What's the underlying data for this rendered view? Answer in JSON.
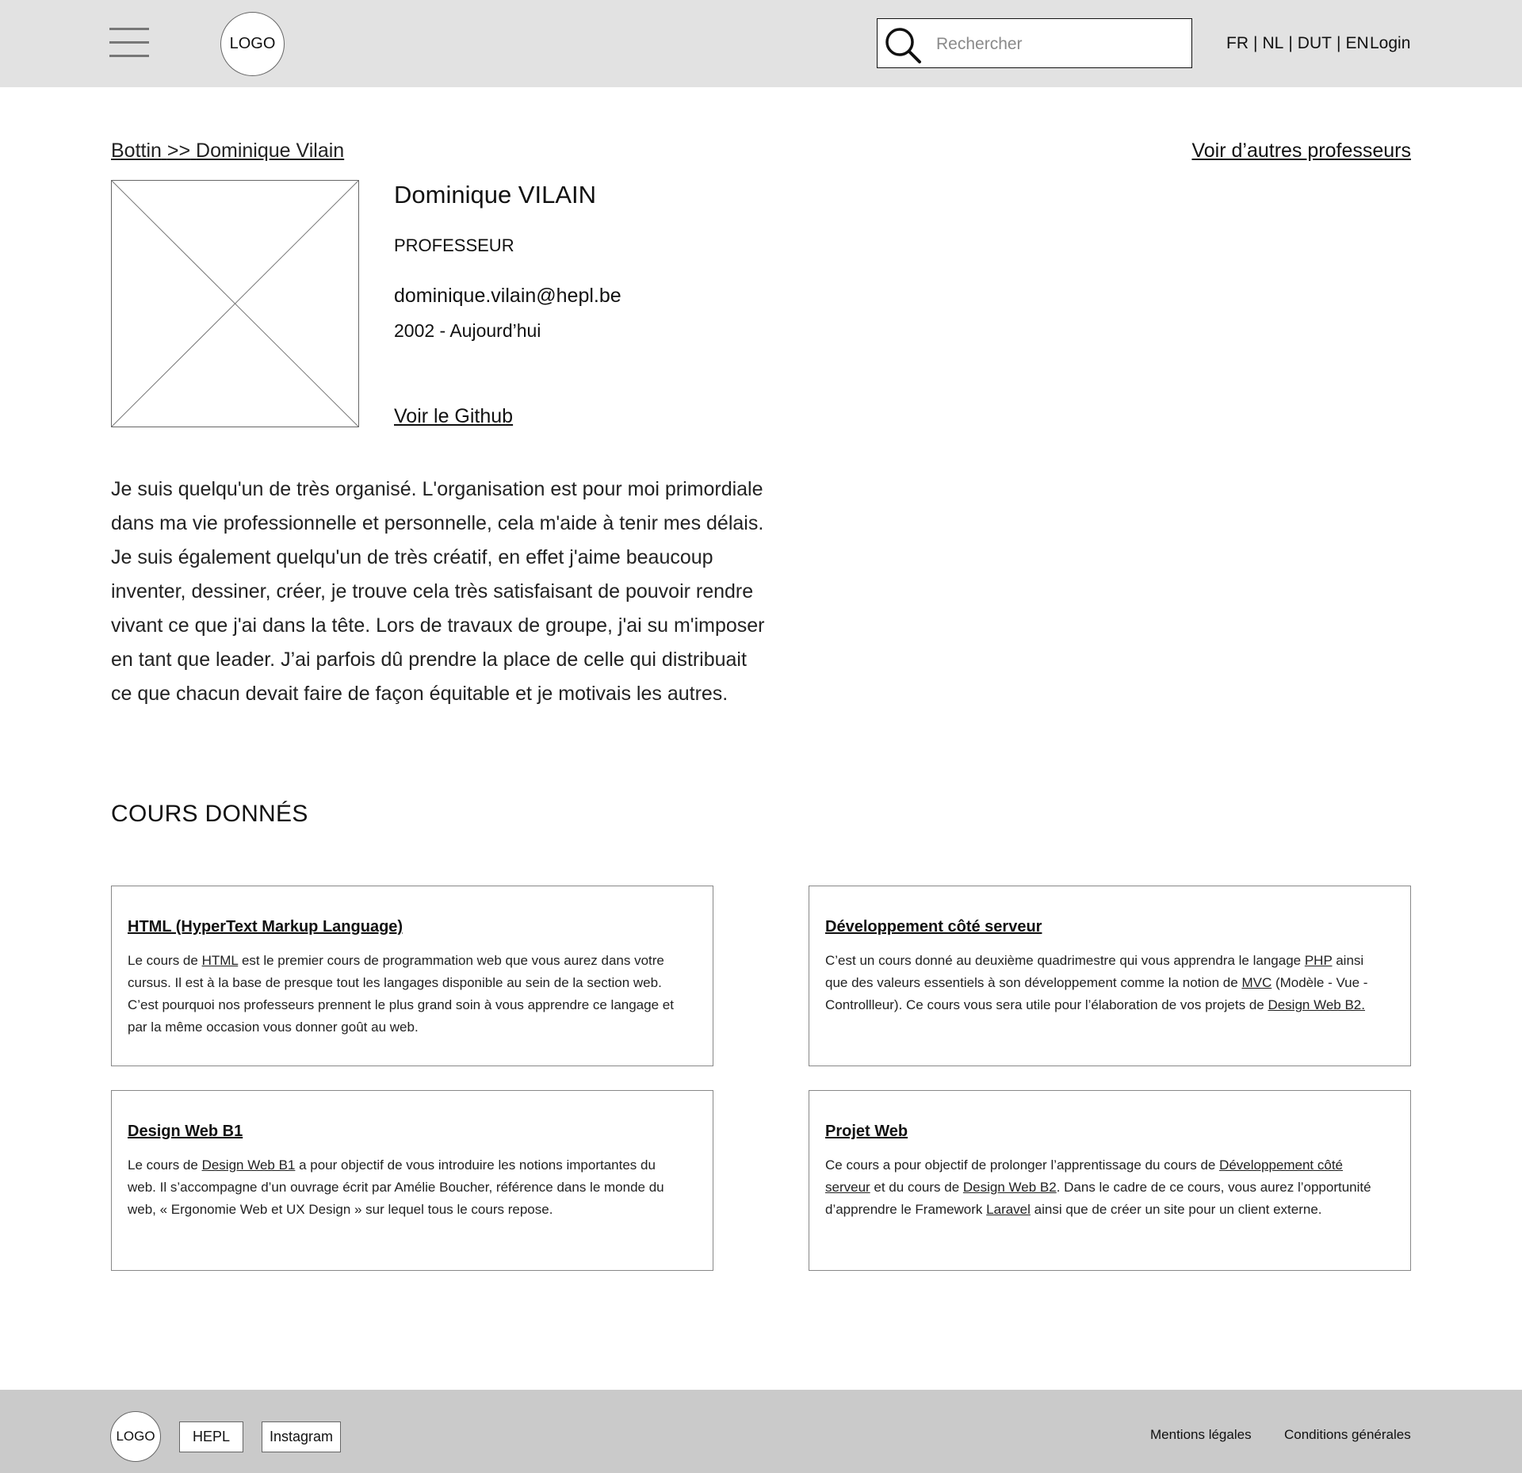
{
  "header": {
    "logo_text": "LOGO",
    "search_placeholder": "Rechercher",
    "languages": [
      "FR",
      "NL",
      "DUT",
      "EN"
    ],
    "login_label": "Login"
  },
  "breadcrumb": {
    "root": "Bottin",
    "separator": ">>",
    "current": "Dominique Vilain"
  },
  "other_professors_link": "Voir d’autres professeurs",
  "professor": {
    "name": "Dominique VILAIN",
    "role": "PROFESSEUR",
    "email": "dominique.vilain@hepl.be",
    "years": "2002 - Aujourd’hui",
    "github_label": "Voir le Github",
    "bio": "Je suis quelqu'un de très organisé. L'organisation est pour moi primordiale dans ma vie professionnelle et personnelle, cela m'aide à tenir mes délais. Je suis également quelqu'un de très créatif, en effet j'aime beaucoup inventer, dessiner, créer, je trouve cela très satisfaisant de pouvoir rendre vivant ce que j'ai dans la tête. Lors de travaux de groupe, j'ai su m'imposer en tant que leader. J’ai parfois dû prendre la place de celle qui distribuait ce que chacun devait faire de façon équitable et je motivais les autres."
  },
  "courses_section_title": "COURS DONNÉS",
  "courses": [
    {
      "title": "HTML (HyperText Markup Language)",
      "description": [
        {
          "text": "Le cours de "
        },
        {
          "text": "HTML",
          "link": true
        },
        {
          "text": " est le premier cours de programmation web que vous aurez dans votre cursus. Il est à la base de presque tout les langages disponible au sein de la section web. C’est pourquoi nos professeurs prennent le plus grand soin à vous apprendre ce langage et par la même occasion vous donner goût au web."
        }
      ]
    },
    {
      "title": "Développement côté serveur",
      "description": [
        {
          "text": "C’est un cours donné au deuxième quadrimestre qui vous apprendra le langage "
        },
        {
          "text": "PHP",
          "link": true
        },
        {
          "text": " ainsi que des valeurs essentiels à son développement comme la notion de "
        },
        {
          "text": "MVC",
          "link": true
        },
        {
          "text": " (Modèle - Vue - Controllleur). Ce cours vous sera utile pour l’élaboration de vos projets de "
        },
        {
          "text": "Design Web B2.",
          "link": true
        }
      ]
    },
    {
      "title": "Design Web B1",
      "description": [
        {
          "text": "Le cours de "
        },
        {
          "text": "Design Web B1",
          "link": true
        },
        {
          "text": " a pour objectif de vous introduire les notions importantes du web. Il s’accompagne d’un ouvrage écrit par Amélie Boucher, référence dans le monde du web, « Ergonomie Web et UX Design » sur lequel tous le cours repose."
        }
      ]
    },
    {
      "title": "Projet Web",
      "description": [
        {
          "text": "Ce cours a pour objectif de prolonger l’apprentissage du cours de "
        },
        {
          "text": "Développement côté serveur",
          "link": true
        },
        {
          "text": " et du cours de "
        },
        {
          "text": "Design Web B2",
          "link": true
        },
        {
          "text": ". Dans le cadre de ce cours, vous aurez l’opportunité d’apprendre le Framework "
        },
        {
          "text": "Laravel",
          "link": true
        },
        {
          "text": " ainsi que de créer un site pour un client externe."
        }
      ]
    }
  ],
  "footer": {
    "logo_text": "LOGO",
    "hepl_label": "HEPL",
    "instagram_label": "Instagram",
    "legal_label": "Mentions légales",
    "terms_label": "Conditions générales"
  },
  "colors": {
    "header_bg": "#e2e2e2",
    "footer_bg": "#cacaca"
  },
  "icons": [
    "menu-icon",
    "search-icon",
    "image-placeholder-icon"
  ]
}
